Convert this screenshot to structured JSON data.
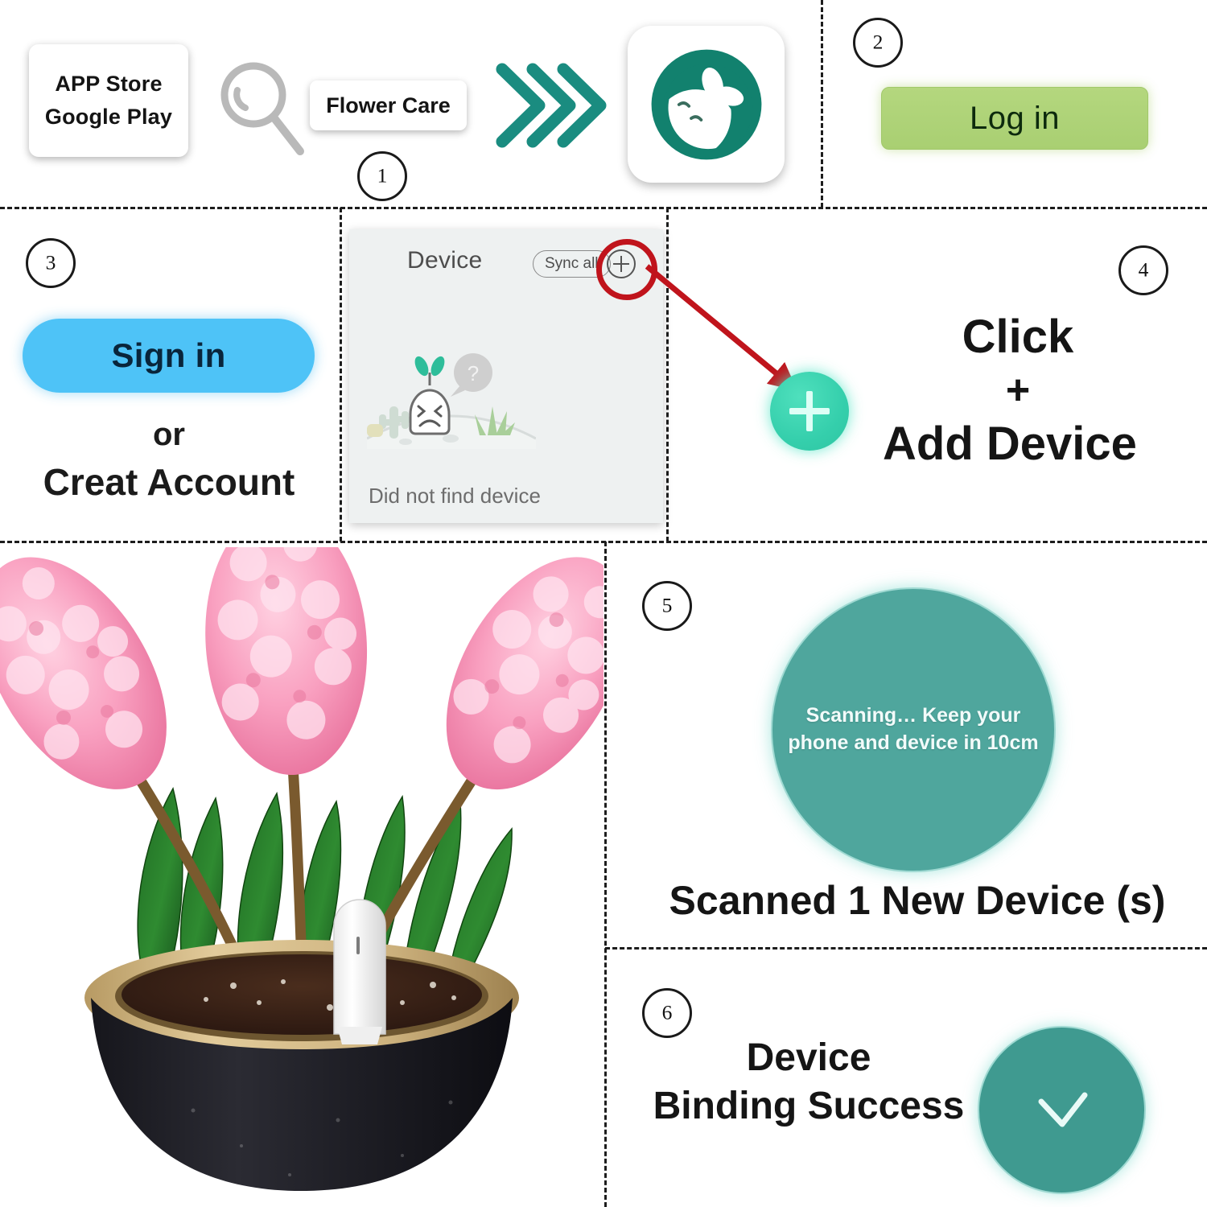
{
  "steps": {
    "one": "①",
    "two": "②",
    "three": "③",
    "four": "④",
    "five": "⑤",
    "six": "⑥"
  },
  "step1": {
    "store_line1": "APP Store",
    "store_line2": "Google Play",
    "search_icon": "search-icon",
    "app_name": "Flower Care",
    "arrows_icon": "triple-chevron-right-icon",
    "app_icon": "flower-care-app-icon"
  },
  "step2": {
    "login_label": "Log in",
    "login_color": "#aed07b"
  },
  "step3": {
    "signin_label": "Sign in",
    "signin_color": "#4ec3f7",
    "or_label": "or",
    "create_account_label": "Creat Account"
  },
  "device_panel": {
    "title": "Device",
    "sync_all_label": "Sync all",
    "add_icon": "plus-circle-icon",
    "highlight_color": "#c0141c",
    "empty_art": "sad-sprout-empty-state-icon",
    "footer_text": "Did not find device"
  },
  "step4": {
    "arrow_icon": "red-arrow-icon",
    "add_button_icon": "plus-icon",
    "add_button_color": "#35cfac",
    "line1": "Click",
    "line2": "+",
    "line3": "Add Device"
  },
  "photo": {
    "alt": "pink-hyacinth-in-pot-with-soil-sensor",
    "device_name": "white-plant-sensor"
  },
  "step5": {
    "scan_text": "Scanning… Keep your phone and device in 10cm",
    "scan_color": "#4fa69d",
    "result_text": "Scanned 1 New Device (s)"
  },
  "step6": {
    "line1": "Device",
    "line2": "Binding Success",
    "check_icon": "checkmark-icon",
    "circle_color": "#3f9a90"
  }
}
